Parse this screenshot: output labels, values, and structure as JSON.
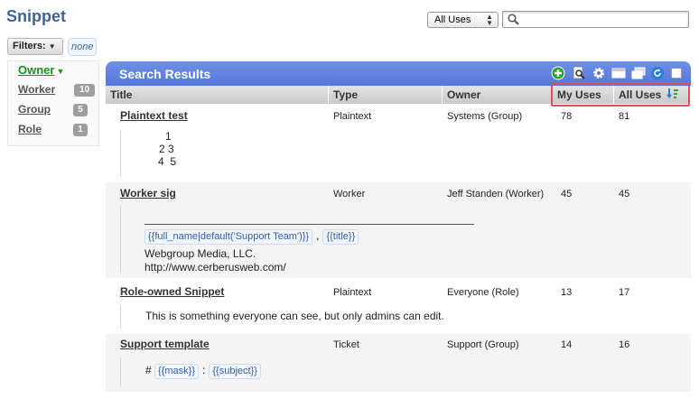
{
  "page": {
    "title": "Snippet"
  },
  "uses_select": {
    "selected": "All Uses"
  },
  "search": {
    "placeholder": "",
    "value": ""
  },
  "filters": {
    "label": "Filters:",
    "current": "none"
  },
  "facet": {
    "header": "Owner",
    "items": [
      {
        "label": "Worker",
        "count": "10"
      },
      {
        "label": "Group",
        "count": "5"
      },
      {
        "label": "Role",
        "count": "1"
      }
    ]
  },
  "results": {
    "title": "Search Results",
    "toolbar_icons": [
      "add-icon",
      "search-icon",
      "gear-icon",
      "view-icon",
      "copy-icon",
      "refresh-icon",
      "select-all-checkbox"
    ],
    "columns": [
      "Title",
      "Type",
      "Owner",
      "My Uses",
      "All Uses"
    ],
    "rows": [
      {
        "title": "Plaintext test",
        "type": "Plaintext",
        "owner": "Systems (Group)",
        "my_uses": "78",
        "all_uses": "81",
        "preview_lines": [
          "1",
          "2 3",
          "4  5"
        ]
      },
      {
        "title": "Worker sig",
        "type": "Worker",
        "owner": "Jeff Standen (Worker)",
        "my_uses": "45",
        "all_uses": "45",
        "placeholders": [
          "{{full_name|default('Support Team')}}",
          "{{title}}"
        ],
        "separator": ",",
        "preview_lines": [
          "Webgroup Media, LLC.",
          "http://www.cerberusweb.com/"
        ]
      },
      {
        "title": "Role-owned Snippet",
        "type": "Plaintext",
        "owner": "Everyone (Role)",
        "my_uses": "13",
        "all_uses": "17",
        "preview_lines": [
          "This is something everyone can see, but only admins can edit."
        ]
      },
      {
        "title": "Support template",
        "type": "Ticket",
        "owner": "Support (Group)",
        "my_uses": "14",
        "all_uses": "16",
        "prefix": "#",
        "placeholders": [
          "{{mask}}",
          "{{subject}}"
        ],
        "separator": ":"
      }
    ]
  },
  "colors": {
    "accent": "#5577d8",
    "title": "#3e6591",
    "facet": "#1c8e1c",
    "highlight": "#e0505a"
  }
}
